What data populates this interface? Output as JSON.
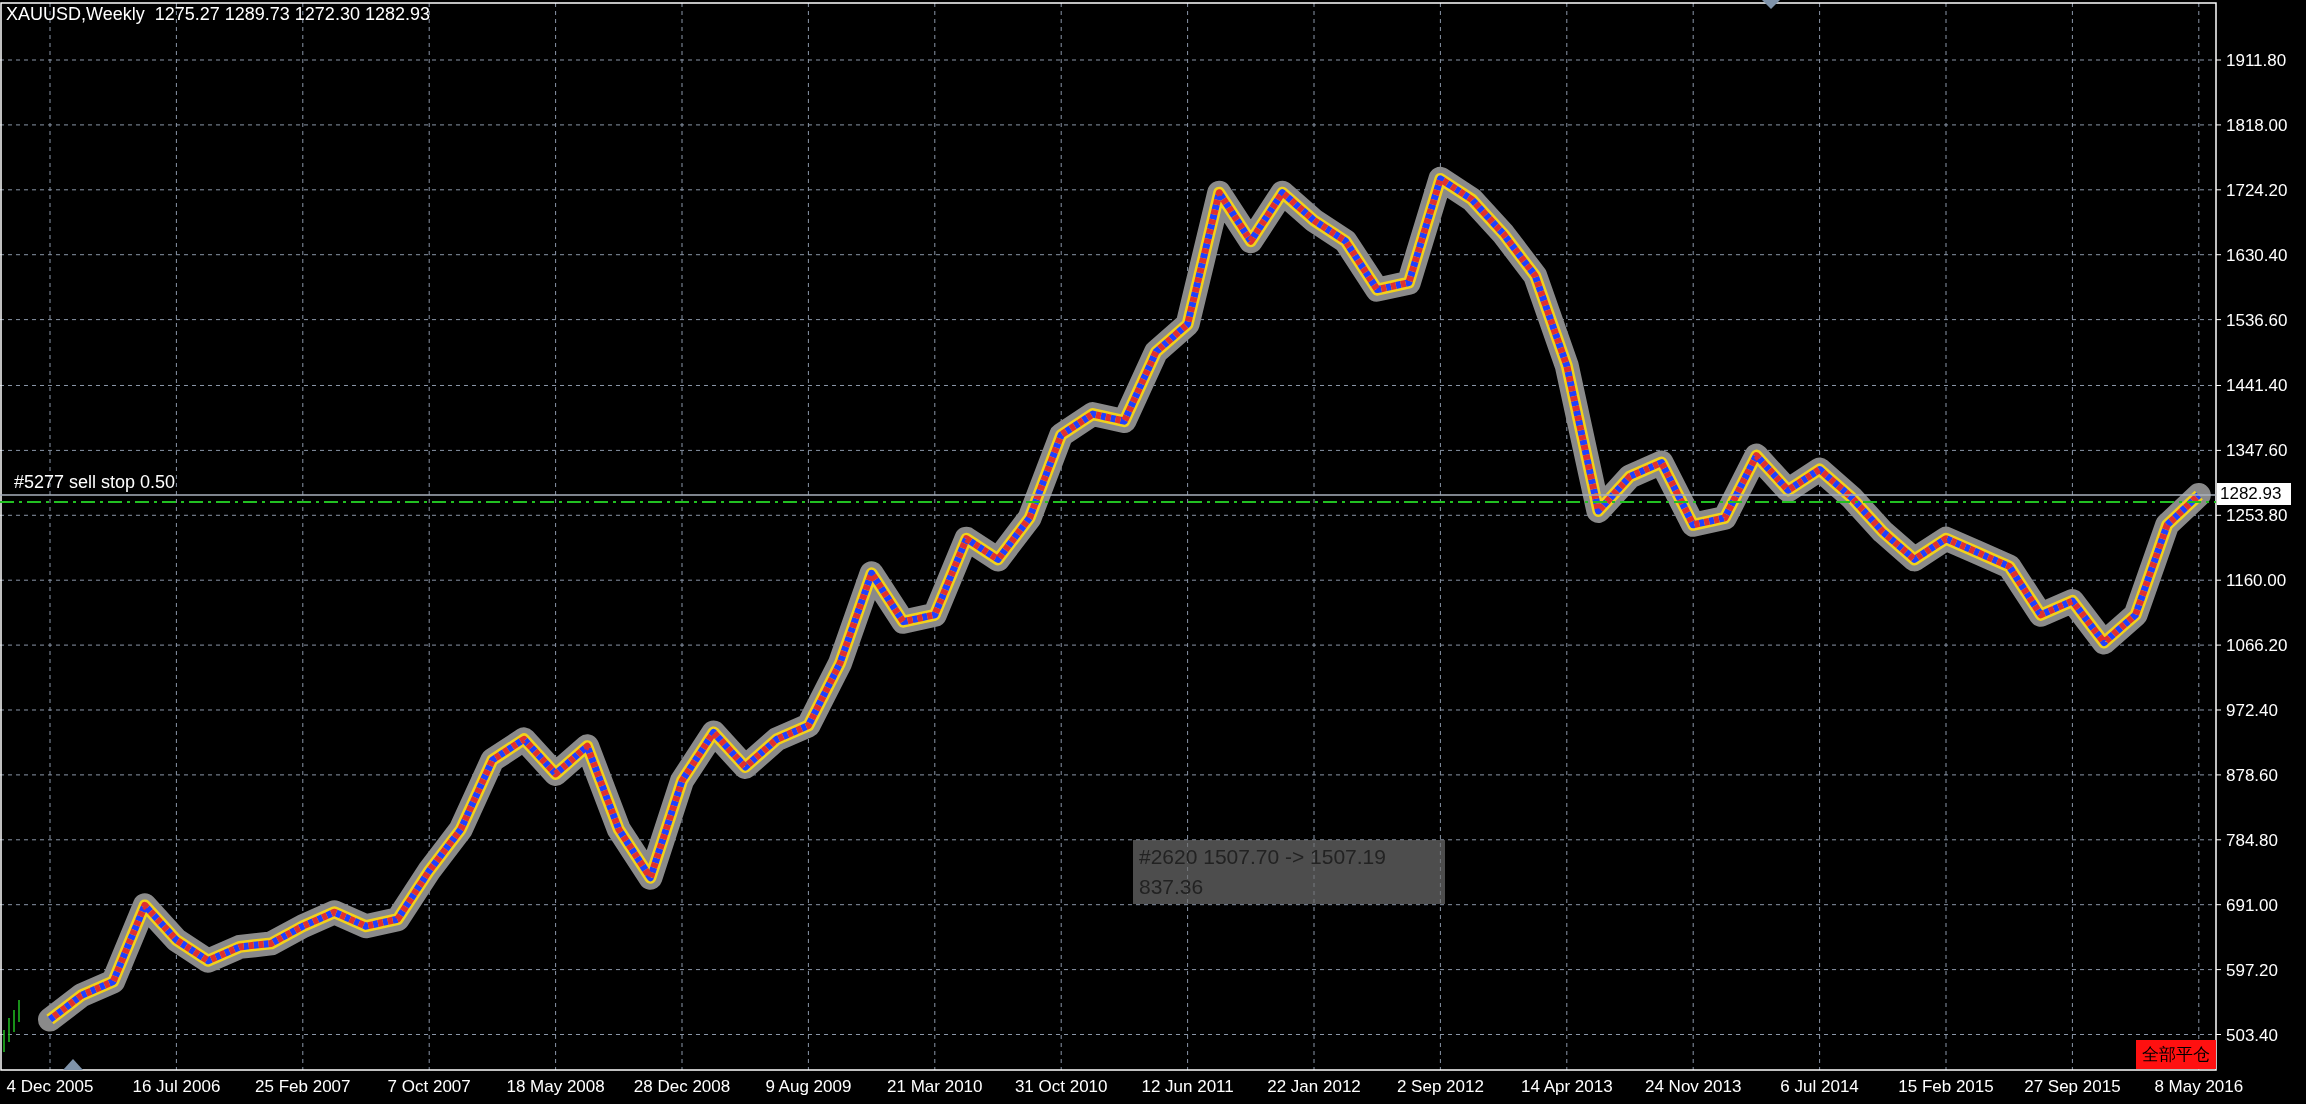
{
  "header": {
    "symbol": "XAUUSD,Weekly",
    "open": "1275.27",
    "high": "1289.73",
    "low": "1272.30",
    "close": "1282.93"
  },
  "order_line": {
    "label": "#5277 sell stop 0.50"
  },
  "bid_label": "1282.93",
  "tooltip": {
    "line_1": "#2620 1507.70 -> 1507.19",
    "line_2": "837.36"
  },
  "close_all_button": "全部平仓",
  "chart": {
    "chart_data": {
      "type": "line",
      "categories": [
        "4 Dec 2005",
        null,
        null,
        null,
        "16 Jul 2006",
        null,
        null,
        null,
        "25 Feb 2007",
        null,
        null,
        null,
        "7 Oct 2007",
        null,
        null,
        null,
        "18 May 2008",
        null,
        null,
        null,
        "28 Dec 2008",
        null,
        null,
        null,
        "9 Aug 2009",
        null,
        null,
        null,
        "21 Mar 2010",
        null,
        null,
        null,
        "31 Oct 2010",
        null,
        null,
        null,
        "12 Jun 2011",
        null,
        null,
        null,
        "22 Jan 2012",
        null,
        null,
        null,
        "2 Sep 2012",
        null,
        null,
        null,
        "14 Apr 2013",
        null,
        null,
        null,
        "24 Nov 2013",
        null,
        null,
        null,
        "6 Jul 2014",
        null,
        null,
        null,
        "15 Feb 2015",
        null,
        null,
        null,
        "27 Sep 2015",
        null,
        null,
        null,
        "8 May 2016"
      ],
      "series": [
        {
          "color": "#e03030",
          "values": [
            525,
            560,
            580,
            690,
            640,
            610,
            630,
            635,
            660,
            680,
            660,
            670,
            740,
            800,
            900,
            930,
            880,
            920,
            800,
            730,
            870,
            940,
            890,
            930,
            950,
            1040,
            1170,
            1100,
            1110,
            1220,
            1190,
            1250,
            1370,
            1400,
            1390,
            1490,
            1530,
            1720,
            1650,
            1720,
            1680,
            1650,
            1580,
            1590,
            1740,
            1710,
            1660,
            1600,
            1470,
            1260,
            1310,
            1330,
            1240,
            1250,
            1340,
            1290,
            1320,
            1280,
            1230,
            1190,
            1220,
            1200,
            1180,
            1110,
            1130,
            1070,
            1110,
            1240,
            1283
          ]
        }
      ],
      "ylim": [
        452.1,
        1994.2
      ],
      "grid": true,
      "line_style": "dotted",
      "yticks": [
        {
          "value": 1911.8,
          "label": "1911.80"
        },
        {
          "value": 1818,
          "label": "1818.00"
        },
        {
          "value": 1724.2,
          "label": "1724.20"
        },
        {
          "value": 1630.4,
          "label": "1630.40"
        },
        {
          "value": 1536.6,
          "label": "1536.60"
        },
        {
          "value": 1441.4,
          "label": "1441.40"
        },
        {
          "value": 1347.6,
          "label": "1347.60"
        },
        {
          "value": 1253.8,
          "label": "1253.80"
        },
        {
          "value": 1160,
          "label": "1160.00"
        },
        {
          "value": 1066.2,
          "label": "1066.20"
        },
        {
          "value": 972.4,
          "label": "972.40"
        },
        {
          "value": 878.6,
          "label": "878.60"
        },
        {
          "value": 784.8,
          "label": "784.80"
        },
        {
          "value": 691,
          "label": "691.00"
        },
        {
          "value": 597.2,
          "label": "597.20"
        },
        {
          "value": 503.4,
          "label": "503.40"
        }
      ]
    }
  }
}
